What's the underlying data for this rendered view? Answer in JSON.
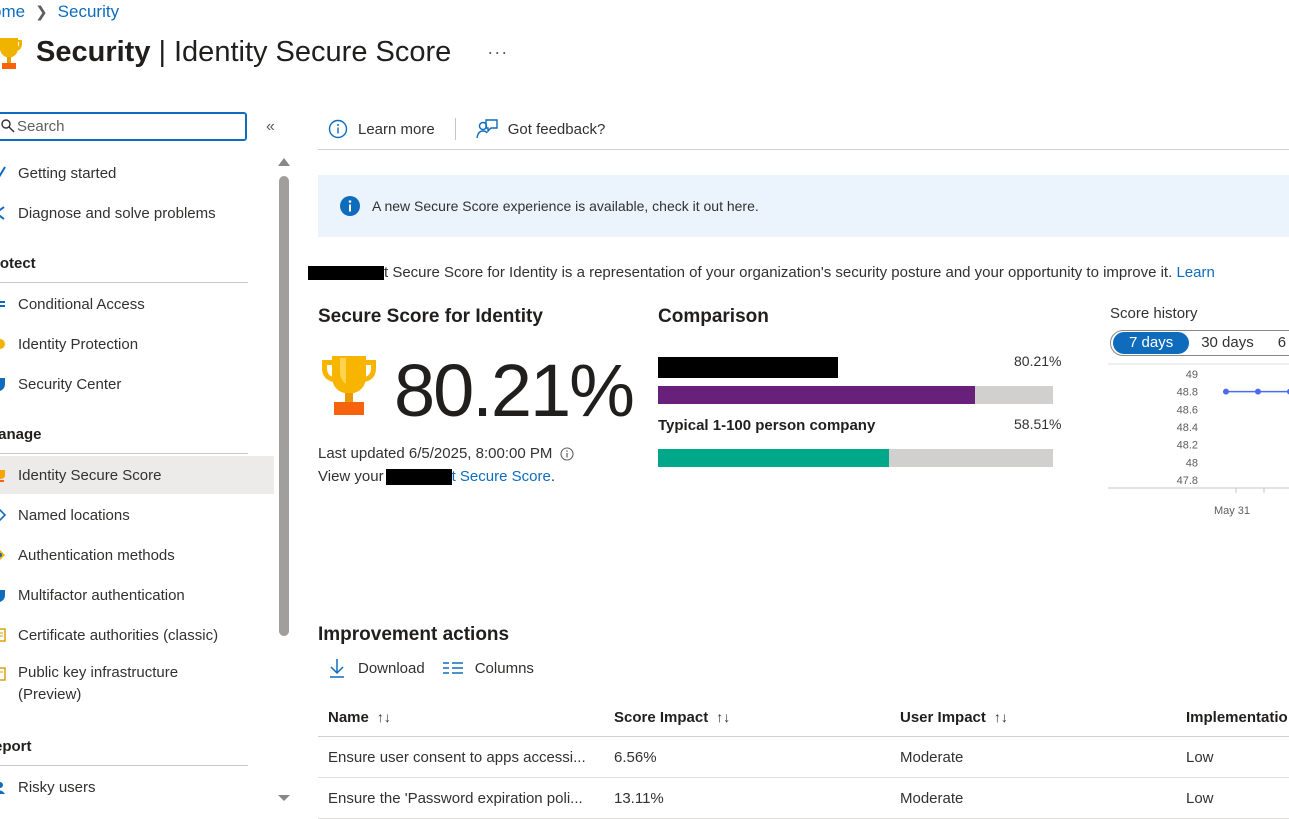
{
  "breadcrumb": {
    "home": "ome",
    "current": "Security"
  },
  "title": {
    "main": "Security",
    "separator": "|",
    "sub": "Identity Secure Score",
    "more": "···"
  },
  "sidebar": {
    "search": {
      "value": "",
      "placeholder": "Search"
    },
    "collapse_glyph": "«",
    "items": [
      {
        "label": "Getting started",
        "icon": "getting-started-icon"
      },
      {
        "label": "Diagnose and solve problems",
        "icon": "wrench-icon"
      }
    ],
    "sections": [
      {
        "title": "rotect",
        "items": [
          {
            "label": "Conditional Access",
            "icon": "conditional-access-icon"
          },
          {
            "label": "Identity Protection",
            "icon": "identity-protection-icon"
          },
          {
            "label": "Security Center",
            "icon": "shield-icon"
          }
        ]
      },
      {
        "title": "lanage",
        "items": [
          {
            "label": "Identity Secure Score",
            "icon": "trophy-icon",
            "active": true
          },
          {
            "label": "Named locations",
            "icon": "location-icon"
          },
          {
            "label": "Authentication methods",
            "icon": "key-icon"
          },
          {
            "label": "Multifactor authentication",
            "icon": "mfa-shield-icon"
          },
          {
            "label": "Certificate authorities (classic)",
            "icon": "certificate-icon"
          },
          {
            "label": "Public key infrastructure",
            "label2": "(Preview)",
            "icon": "pki-icon"
          }
        ]
      },
      {
        "title": "eport",
        "items": [
          {
            "label": "Risky users",
            "icon": "risky-users-icon"
          }
        ]
      }
    ]
  },
  "toolbar": {
    "learn_more": "Learn more",
    "feedback": "Got feedback?"
  },
  "banner": {
    "text": "A new Secure Score experience is available, check it out here.",
    "icon": "info-icon"
  },
  "description": {
    "text": "t Secure Score for Identity is a representation of your organization's security posture and your opportunity to improve it.",
    "link": "Learn"
  },
  "score": {
    "heading": "Secure Score for Identity",
    "value": "80.21%",
    "last_updated": "Last updated 6/5/2025, 8:00:00 PM",
    "view_prefix": "View your",
    "view_link": "t Secure Score",
    "view_suffix": "."
  },
  "comparison": {
    "heading": "Comparison",
    "rows": [
      {
        "label": "",
        "value_text": "80.21%",
        "fraction": 0.8021,
        "color": "#68217a"
      },
      {
        "label": "Typical 1-100 person company",
        "value_text": "58.51%",
        "fraction": 0.5851,
        "color": "#00a88a"
      }
    ]
  },
  "history": {
    "label": "Score history",
    "tabs": [
      "7 days",
      "30 days",
      "6"
    ],
    "active_tab": 0,
    "accent": "#0f6cbd",
    "chart_data": {
      "type": "line",
      "yticks": [
        "49",
        "48.8",
        "48.6",
        "48.4",
        "48.2",
        "48",
        "47.8"
      ],
      "ylim": [
        47.8,
        49
      ],
      "xticks": [
        "May 31"
      ],
      "series": [
        {
          "values": [
            48.8,
            48.8,
            48.8
          ],
          "color": "#4f6bed"
        }
      ]
    }
  },
  "improvement": {
    "heading": "Improvement actions",
    "download": "Download",
    "columns": "Columns",
    "headers": [
      "Name",
      "Score Impact",
      "User Impact",
      "Implementatio"
    ],
    "sort_glyph": "↑↓",
    "rows": [
      [
        "Ensure user consent to apps accessi...",
        "6.56%",
        "Moderate",
        "Low"
      ],
      [
        "Ensure the 'Password expiration poli...",
        "13.11%",
        "Moderate",
        "Low"
      ]
    ]
  }
}
